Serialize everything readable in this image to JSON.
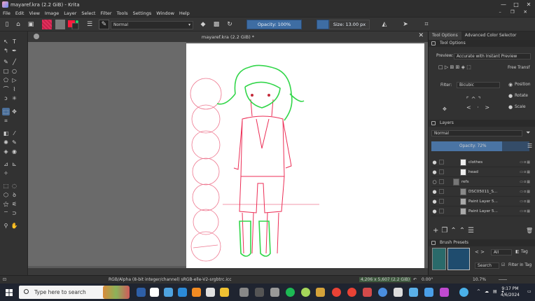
{
  "window": {
    "title": "mayaref.kra (2.2 GiB) - Krita",
    "controls": [
      "—",
      "□",
      "✕"
    ]
  },
  "menubar": {
    "items": [
      "File",
      "Edit",
      "View",
      "Image",
      "Layer",
      "Select",
      "Filter",
      "Tools",
      "Settings",
      "Window",
      "Help"
    ],
    "right_icons": [
      "minimize-icon",
      "restore-icon",
      "close-icon"
    ]
  },
  "toolbar": {
    "blend_mode": "Normal",
    "opacity": "Opacity: 100%",
    "size": "Size: 13.00 px",
    "opacity_fraction": 1.0
  },
  "document": {
    "tab_title": "mayaref.kra (2.2 GiB) *"
  },
  "dock": {
    "tabs": [
      "Tool Options",
      "Advanced Color Selector"
    ],
    "tool_options": {
      "header": "Tool Options",
      "preview_label": "Preview:",
      "preview_value": "Accurate with Instant Preview",
      "free_transform": "Free Transf",
      "filter_label": "Filter:",
      "filter_value": "Bicubic",
      "position_label": "Position",
      "rotate_label": "Rotate",
      "scale_label": "Scale"
    },
    "layers": {
      "header": "Layers",
      "blend_mode": "Normal",
      "opacity": "Opacity:  72%",
      "opacity_fraction": 0.72,
      "rows": [
        {
          "name": "clothes"
        },
        {
          "name": "head"
        },
        {
          "name": "refs"
        },
        {
          "name": "DSC05011_S..."
        },
        {
          "name": "Paint Layer 5..."
        },
        {
          "name": "Paint Layer 5..."
        }
      ]
    },
    "brush_presets": {
      "header": "Brush Presets",
      "filter": "All",
      "tag": "Tag",
      "search": "Search",
      "filter_in_tag": "Filter in Tag"
    }
  },
  "statusbar": {
    "color_info": "RGB/Alpha (8-bit integer/channel)  sRGB-elle-V2-srgbtrc.icc",
    "dimensions": "4,206 x 5,607 (2.2 GiB)",
    "rotation": "0.00°",
    "zoom": "10.7%"
  },
  "taskbar": {
    "search_placeholder": "Type here to search",
    "time": "9:17 PM",
    "date": "4/6/2024"
  }
}
